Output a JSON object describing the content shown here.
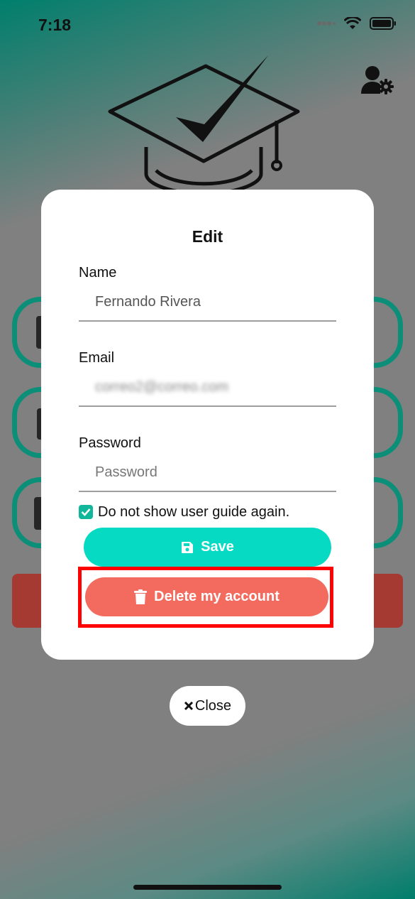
{
  "status_bar": {
    "time": "7:18"
  },
  "dialog": {
    "title": "Edit",
    "fields": [
      {
        "label": "Name",
        "value": "Fernando Rivera",
        "placeholder": ""
      },
      {
        "label": "Email",
        "value": "correo2@correo.com",
        "placeholder": ""
      },
      {
        "label": "Password",
        "value": "",
        "placeholder": "Password"
      }
    ],
    "checkbox": {
      "label": "Do not show user guide again.",
      "checked": true
    },
    "save_label": "Save",
    "delete_label": "Delete my account"
  },
  "close_label": "Close",
  "colors": {
    "save": "#07dac3",
    "delete": "#f36a5e",
    "highlight": "#ff0000",
    "accent": "#0c8f78"
  },
  "icons": [
    "user-settings-icon",
    "graduation-cap-logo",
    "save-icon",
    "trash-icon",
    "close-icon",
    "checkmark-icon",
    "wifi-icon",
    "battery-icon",
    "signal-icon"
  ]
}
